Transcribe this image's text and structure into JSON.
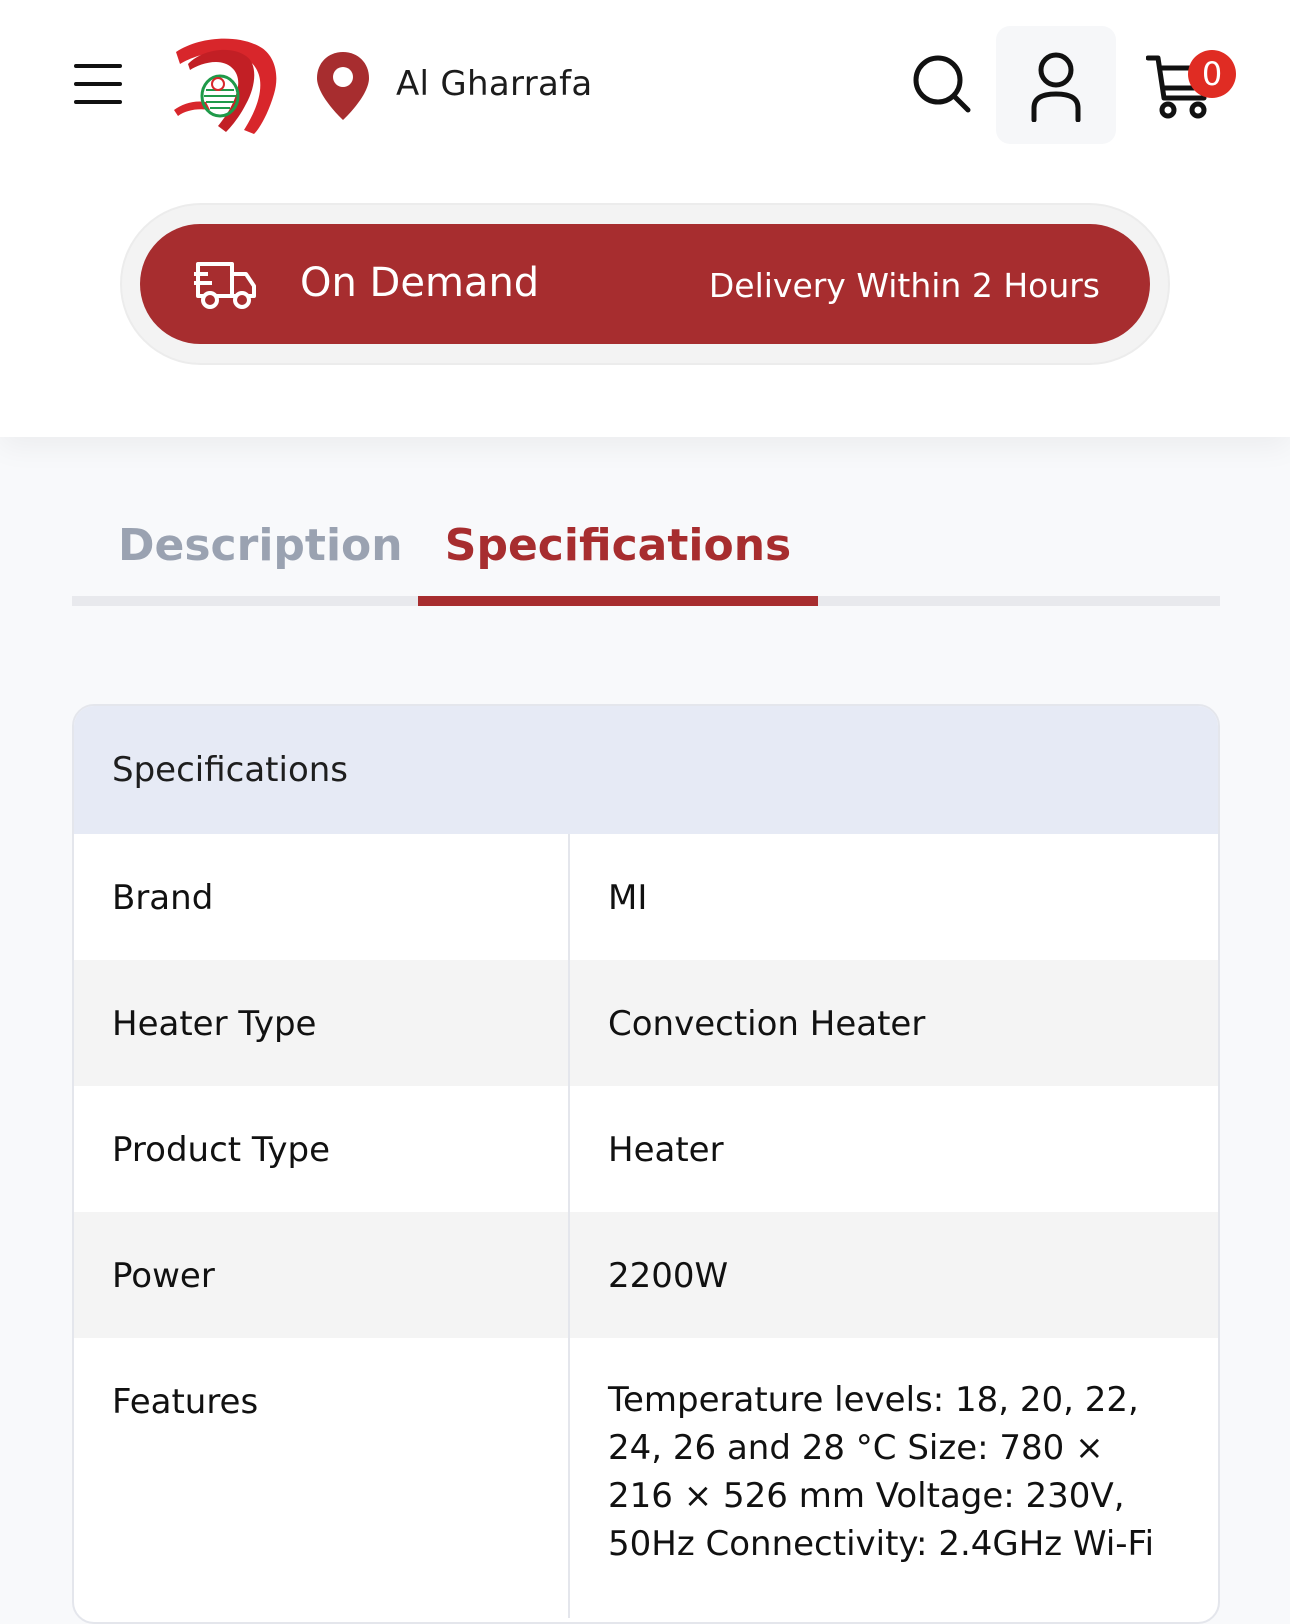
{
  "header": {
    "location": "Al Gharrafa",
    "cart_count": "0"
  },
  "banner": {
    "title": "On Demand",
    "subtitle": "Delivery Within 2 Hours"
  },
  "tabs": [
    {
      "label": "Description",
      "active": false
    },
    {
      "label": "Specifications",
      "active": true
    }
  ],
  "specifications": {
    "heading": "Specifications",
    "rows": [
      {
        "key": "Brand",
        "value": "MI"
      },
      {
        "key": "Heater Type",
        "value": "Convection Heater"
      },
      {
        "key": "Product Type",
        "value": "Heater"
      },
      {
        "key": "Power",
        "value": "2200W"
      },
      {
        "key": "Features",
        "value": "Temperature levels: 18, 20, 22, 24, 26 and 28 °C Size: 780 × 216 × 526 mm Voltage: 230V, 50Hz Connectivity: 2.4GHz Wi-Fi"
      }
    ]
  },
  "colors": {
    "accent": "#a72d2f",
    "badge": "#e02c23",
    "inactive_tab": "#9aa2b1",
    "spec_header_bg": "#e6eaf5"
  },
  "icons": [
    "menu-icon",
    "logo",
    "location-pin-icon",
    "search-icon",
    "user-icon",
    "cart-icon",
    "delivery-truck-icon"
  ]
}
